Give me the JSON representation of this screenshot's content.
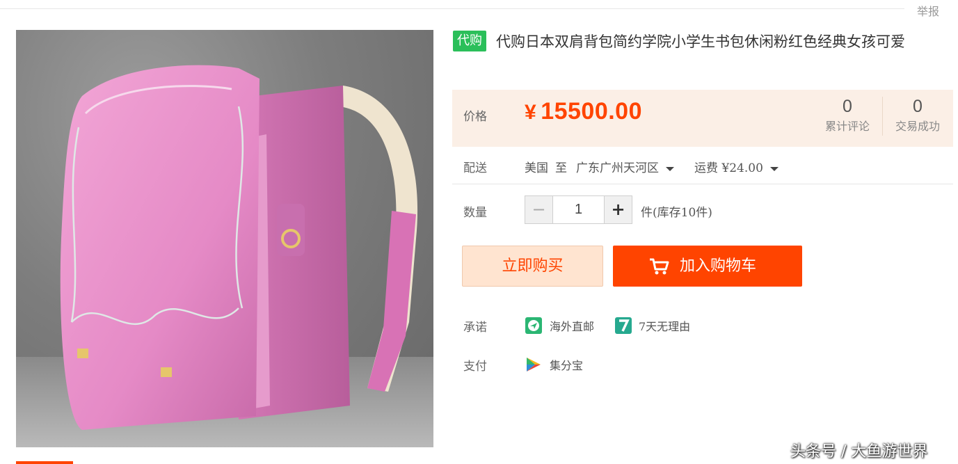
{
  "header": {
    "report_label": "举报"
  },
  "product": {
    "tag": "代购",
    "title": "代购日本双肩背包简约学院小学生书包休闲粉红色经典女孩可爱",
    "image_alt": "pink leather school backpack",
    "colors": {
      "accent": "#ff4400",
      "tag_green": "#2bbf5a",
      "price_bg": "#fbefe6"
    }
  },
  "price": {
    "label": "价格",
    "currency": "¥",
    "amount": "15500.00",
    "stats": [
      {
        "count": "0",
        "label": "累计评论"
      },
      {
        "count": "0",
        "label": "交易成功"
      }
    ]
  },
  "shipping": {
    "label": "配送",
    "from": "美国",
    "to_word": "至",
    "destination": "广东广州天河区",
    "fee": "运费 ¥24.00"
  },
  "quantity": {
    "label": "数量",
    "minus": "−",
    "plus": "+",
    "value": "1",
    "stock_text": "件(库存10件)"
  },
  "actions": {
    "buy_now": "立即购买",
    "add_to_cart": "加入购物车"
  },
  "promise": {
    "label": "承诺",
    "items": [
      {
        "icon": "plane-icon",
        "color": "#2bb673",
        "text": "海外直邮"
      },
      {
        "icon": "seven-days-icon",
        "color": "#26a98f",
        "text": "7天无理由"
      }
    ]
  },
  "payment": {
    "label": "支付",
    "method": "集分宝",
    "icon": "jifenbao-icon"
  },
  "watermark": "头条号 / 大鱼游世界"
}
